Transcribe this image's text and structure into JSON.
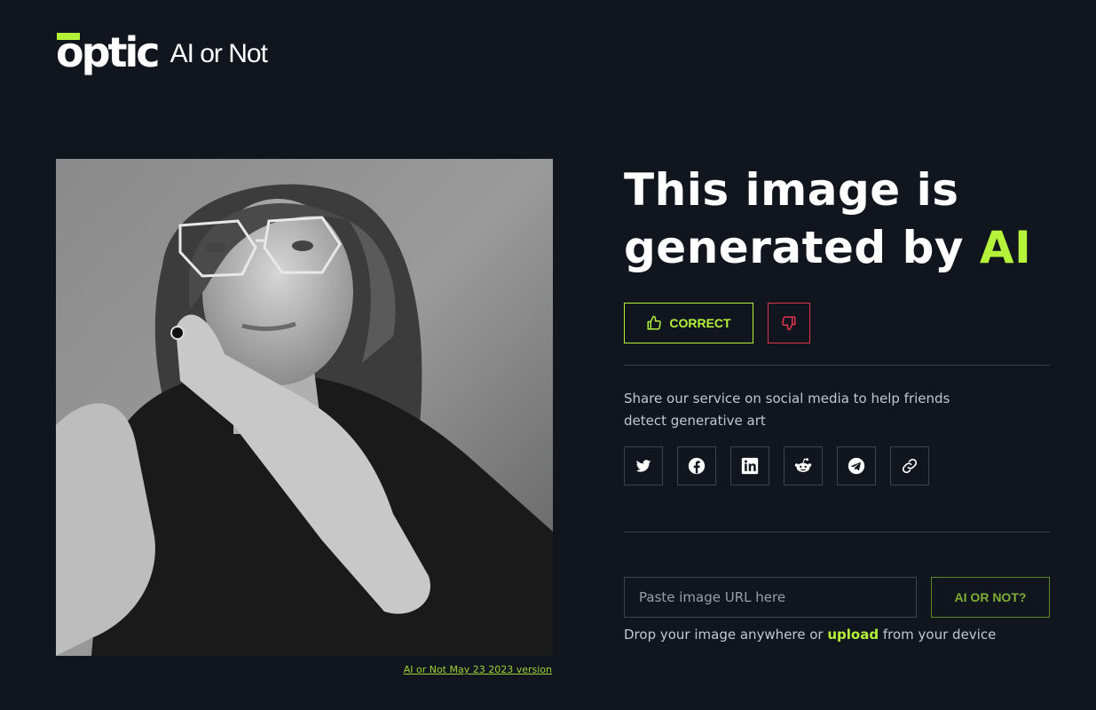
{
  "brand": {
    "logo": "optic",
    "product": "AI or Not",
    "accent_color": "#b5f23a"
  },
  "photo": {
    "icon": "portrait-photo",
    "caption_link": "AI or Not May 23 2023 version"
  },
  "result": {
    "headline_prefix": "This image is generated by ",
    "headline_accent": "AI"
  },
  "feedback": {
    "correct_label": "CORRECT",
    "correct_icon": "thumbs-up-icon",
    "incorrect_icon": "thumbs-down-icon"
  },
  "share": {
    "text": "Share our service on social media to help friends detect generative art",
    "buttons": [
      "twitter-icon",
      "facebook-icon",
      "linkedin-icon",
      "reddit-icon",
      "telegram-icon",
      "link-icon"
    ]
  },
  "check": {
    "url_placeholder": "Paste image URL here",
    "url_value": "",
    "submit_label": "AI OR NOT?",
    "drop_prefix": "Drop your image anywhere or ",
    "upload_label": "upload",
    "drop_suffix": " from your device"
  }
}
